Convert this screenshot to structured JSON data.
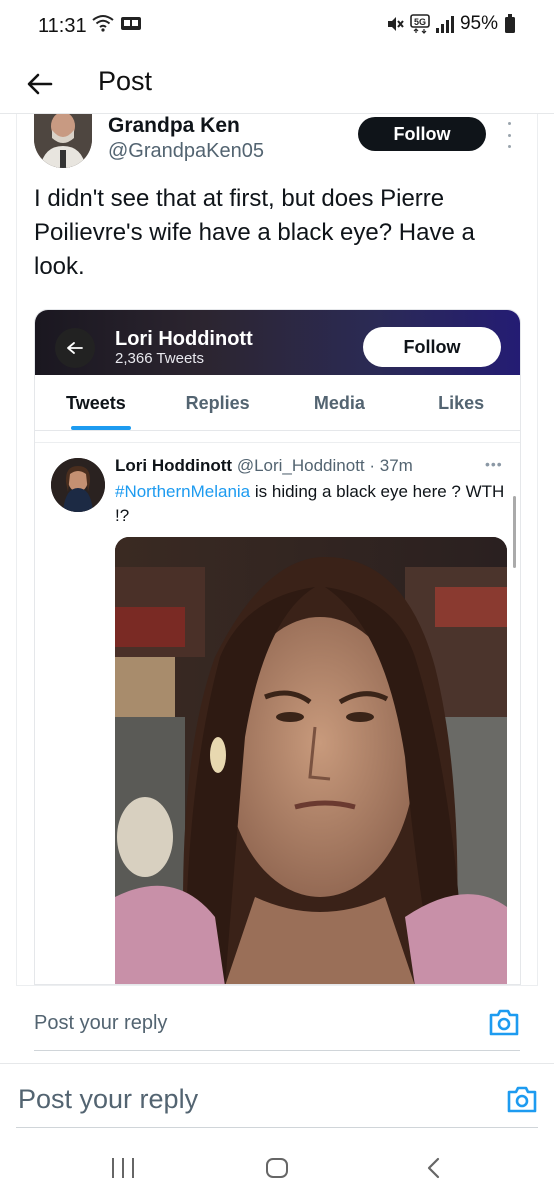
{
  "status_bar": {
    "time": "11:31",
    "battery": "95%"
  },
  "header": {
    "title": "Post"
  },
  "tweet": {
    "author_name": "Grandpa Ken",
    "author_handle": "@GrandpaKen05",
    "follow_label": "Follow",
    "text": "I didn't see that at first, but does  Pierre Poilievre's wife have a black eye? Have a look."
  },
  "embedded": {
    "profile_name": "Lori Hoddinott",
    "tweet_count": "2,366 Tweets",
    "follow_label": "Follow",
    "tabs": [
      "Tweets",
      "Replies",
      "Media",
      "Likes"
    ],
    "inner_tweet": {
      "name": "Lori Hoddinott",
      "handle": "@Lori_Hoddinott",
      "time": "37m",
      "hashtag": "#NorthernMelania",
      "text_rest": " is hiding a black eye here ? WTH !?"
    }
  },
  "reply": {
    "inner_placeholder": "Post your reply",
    "outer_placeholder": "Post your reply"
  },
  "colors": {
    "accent": "#1d9bf0",
    "text": "#0f1419",
    "secondary": "#536471"
  }
}
